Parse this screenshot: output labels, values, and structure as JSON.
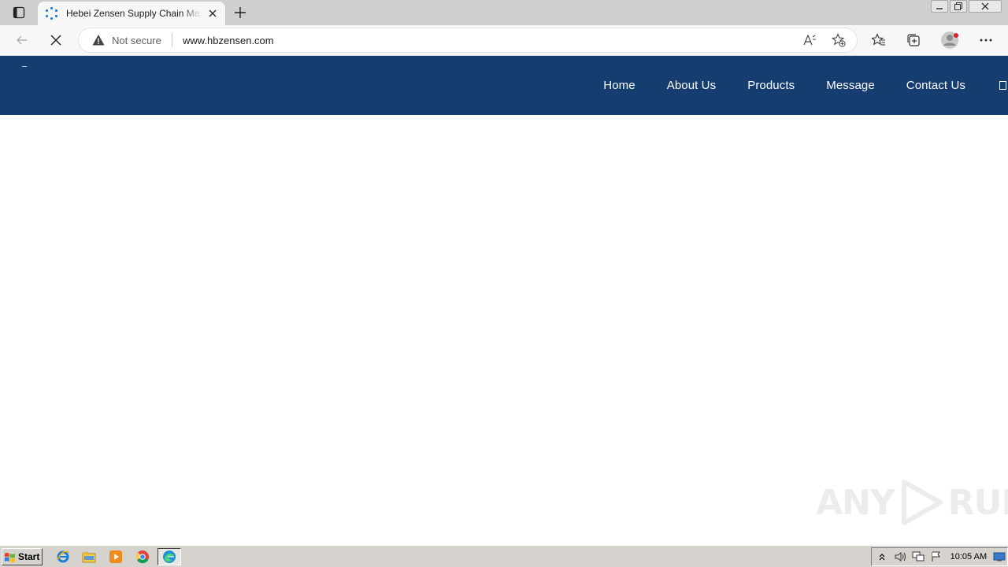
{
  "browser": {
    "tab": {
      "title": "Hebei Zensen Supply Chain Management Co., Ltd."
    },
    "address": {
      "security_label": "Not secure",
      "url": "www.hbzensen.com"
    }
  },
  "site": {
    "header_color": "#163d70",
    "nav": [
      {
        "label": "Home"
      },
      {
        "label": "About Us"
      },
      {
        "label": "Products"
      },
      {
        "label": "Message"
      },
      {
        "label": "Contact Us"
      }
    ]
  },
  "watermark": {
    "left": "ANY",
    "right": "RUN"
  },
  "taskbar": {
    "start_label": "Start",
    "clock": "10:05 AM",
    "apps": [
      "ie-icon",
      "explorer-icon",
      "media-player-icon",
      "chrome-icon",
      "edge-icon"
    ]
  }
}
